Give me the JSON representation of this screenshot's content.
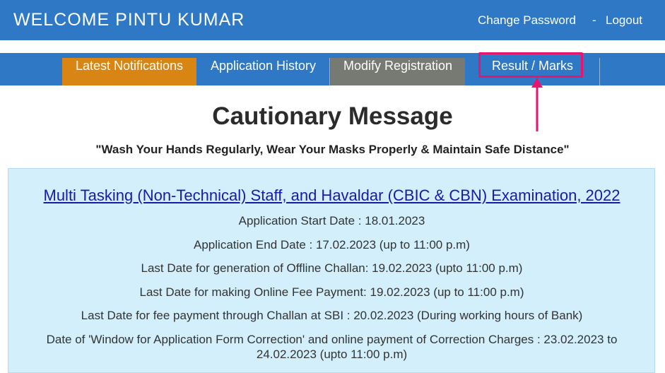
{
  "header": {
    "welcome": "WELCOME PINTU KUMAR",
    "change_password": "Change Password",
    "separator": "-",
    "logout": "Logout"
  },
  "nav": {
    "tabs": [
      {
        "label": "Latest Notifications"
      },
      {
        "label": "Application History"
      },
      {
        "label": "Modify Registration"
      },
      {
        "label": "Result / Marks"
      }
    ]
  },
  "caution": {
    "title": "Cautionary Message",
    "subtitle": "\"Wash Your Hands Regularly, Wear Your Masks Properly & Maintain Safe Distance\""
  },
  "exam": {
    "title": "Multi Tasking (Non-Technical) Staff, and Havaldar (CBIC & CBN) Examination, 2022",
    "lines": [
      "Application Start Date : 18.01.2023",
      "Application End Date : 17.02.2023 (up to 11:00 p.m)",
      "Last Date for generation of Offline Challan: 19.02.2023 (upto 11:00 p.m)",
      "Last Date for making Online Fee Payment: 19.02.2023 (up to 11:00 p.m)",
      "Last Date for fee payment through Challan at SBI : 20.02.2023 (During working hours of Bank)",
      "Date of 'Window for Application Form Correction' and online payment of Correction Charges : 23.02.2023 to 24.02.2023 (upto 11:00 p.m)"
    ]
  },
  "colors": {
    "header_blue": "#2e78c6",
    "tab_orange": "#d98514",
    "tab_grey": "#777a72",
    "highlight_pink": "#e8146e",
    "panel_bg": "#d2effb"
  }
}
